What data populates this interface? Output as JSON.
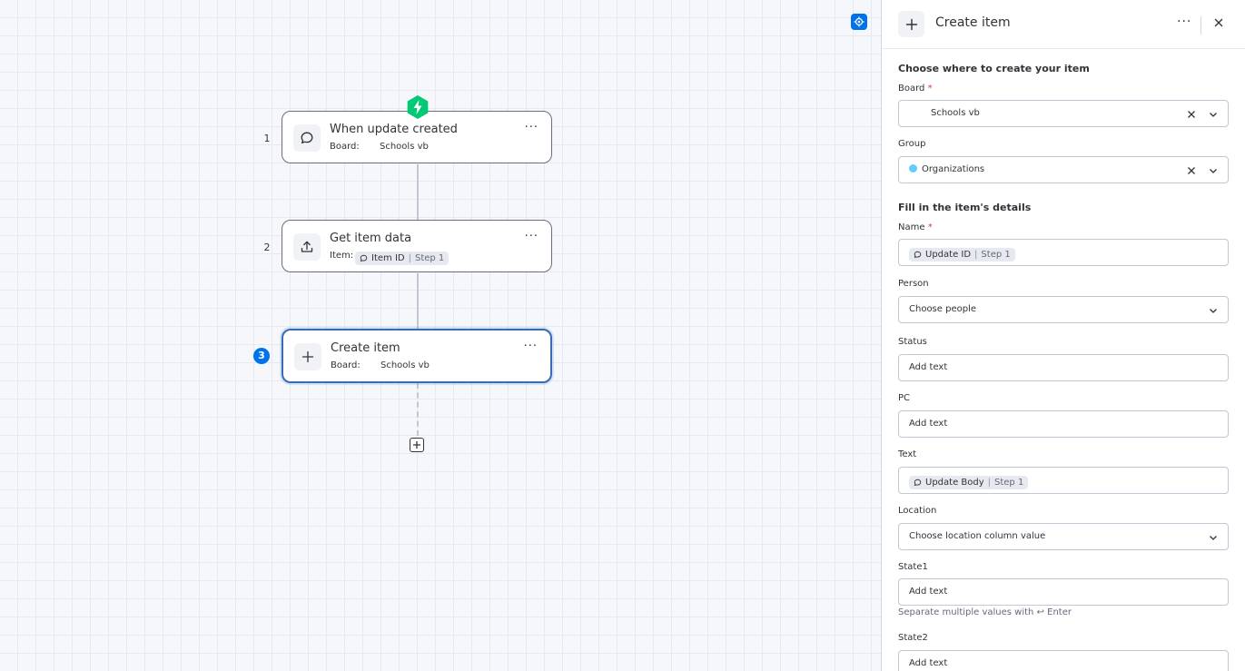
{
  "canvas": {
    "steps": [
      {
        "number": "1",
        "title": "When update created",
        "label": "Board:",
        "value": "Schools vb",
        "icon": "speech-bubble-icon"
      },
      {
        "number": "2",
        "title": "Get item data",
        "label": "Item:",
        "chip": {
          "name": "Item ID",
          "step": "Step 1"
        },
        "icon": "upload-icon"
      },
      {
        "number": "3",
        "title": "Create item",
        "label": "Board:",
        "value": "Schools vb",
        "icon": "plus-icon"
      }
    ],
    "menu_glyph": "···",
    "colors": {
      "trigger": "#00c875",
      "active": "#0073ea"
    }
  },
  "panel": {
    "title": "Create item",
    "more_glyph": "···",
    "section1": "Choose where to create your item",
    "board": {
      "label": "Board",
      "required": "*",
      "value": "Schools vb"
    },
    "group": {
      "label": "Group",
      "value": "Organizations",
      "color": "#66ccff"
    },
    "section2": "Fill in the item's details",
    "name": {
      "label": "Name",
      "required": "*",
      "chip": {
        "name": "Update ID",
        "step": "Step 1"
      }
    },
    "person": {
      "label": "Person",
      "placeholder": "Choose people"
    },
    "status": {
      "label": "Status",
      "placeholder": "Add text"
    },
    "pc": {
      "label": "PC",
      "placeholder": "Add text"
    },
    "text": {
      "label": "Text",
      "chip": {
        "name": "Update Body",
        "step": "Step 1"
      }
    },
    "location": {
      "label": "Location",
      "placeholder": "Choose location column value"
    },
    "state1": {
      "label": "State1",
      "placeholder": "Add text",
      "hint": "Separate multiple values with ↩ Enter"
    },
    "state2": {
      "label": "State2",
      "placeholder": "Add text"
    }
  }
}
